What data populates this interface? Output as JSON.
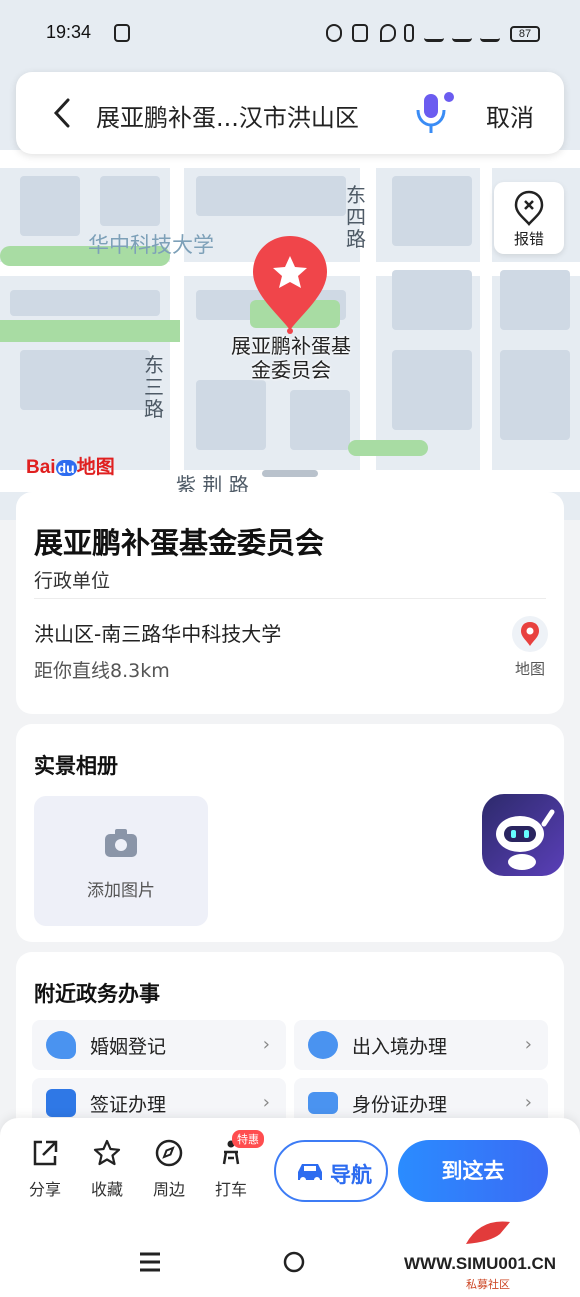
{
  "status_bar": {
    "time": "19:34",
    "battery": "87"
  },
  "search": {
    "text": "展亚鹏补蛋...汉市洪山区",
    "cancel_label": "取消"
  },
  "map": {
    "report_label": "报错",
    "labels": {
      "university": "华中科技大学",
      "road_east4": "东四路",
      "road_east3": "东三路",
      "road_bottom": "紫 荆 路"
    },
    "poi_label": "展亚鹏补蛋基金委员会",
    "logo": "Bai地图",
    "logo_mid": "du"
  },
  "poi": {
    "name": "展亚鹏补蛋基金委员会",
    "category": "行政单位",
    "address": "洪山区-南三路华中科技大学",
    "distance": "距你直线8.3km",
    "map_button": "地图"
  },
  "album": {
    "title": "实景相册",
    "add_label": "添加图片"
  },
  "gov": {
    "title": "附近政务办事",
    "items": [
      {
        "label": "婚姻登记",
        "icon": "heart-icon",
        "color": "#3b8cf0"
      },
      {
        "label": "出入境办理",
        "icon": "plane-icon",
        "color": "#3b8cf0"
      },
      {
        "label": "签证办理",
        "icon": "passport-icon",
        "color": "#2f78e6"
      },
      {
        "label": "身份证办理",
        "icon": "id-card-icon",
        "color": "#3b8cf0"
      }
    ]
  },
  "actions": {
    "share": "分享",
    "favorite": "收藏",
    "nearby": "周边",
    "taxi": "打车",
    "promo": "特惠",
    "navigate": "导航",
    "go_here": "到这去"
  },
  "watermark": {
    "main": "WWW.SIMU001.CN",
    "sub": "私募社区"
  },
  "colors": {
    "accent": "#2d6cf0",
    "pin": "#f0454a"
  }
}
